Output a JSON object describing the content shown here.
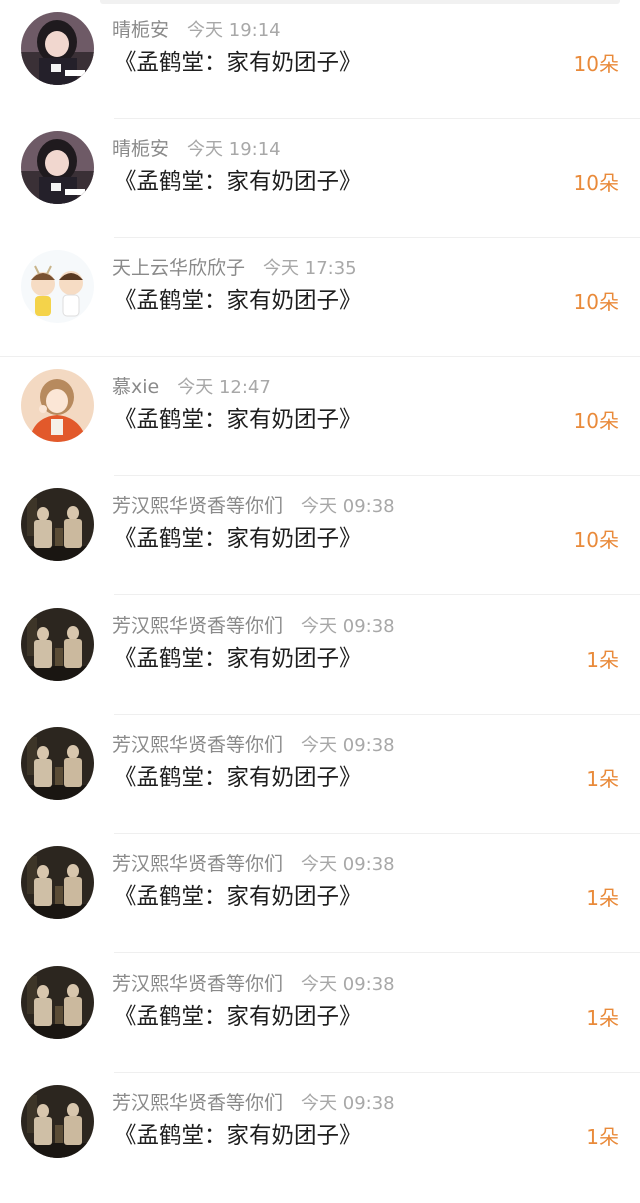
{
  "gifts": [
    {
      "avatar": "girl-dark-hair-avatar",
      "name": "晴栀安",
      "time": "今天 19:14",
      "title": "《孟鹤堂：家有奶团子》",
      "count": "10朵"
    },
    {
      "avatar": "girl-dark-hair-avatar",
      "name": "晴栀安",
      "time": "今天 19:14",
      "title": "《孟鹤堂：家有奶团子》",
      "count": "10朵"
    },
    {
      "avatar": "cartoon-kids-avatar",
      "name": "天上云华欣欣子",
      "time": "今天 17:35",
      "title": "《孟鹤堂：家有奶团子》",
      "count": "10朵"
    },
    {
      "avatar": "anime-boy-orange-avatar",
      "name": "慕xie",
      "time": "今天 12:47",
      "title": "《孟鹤堂：家有奶团子》",
      "count": "10朵"
    },
    {
      "avatar": "stage-duo-avatar",
      "name": "芳汉熙华贤香等你们",
      "time": "今天 09:38",
      "title": "《孟鹤堂：家有奶团子》",
      "count": "10朵"
    },
    {
      "avatar": "stage-duo-avatar",
      "name": "芳汉熙华贤香等你们",
      "time": "今天 09:38",
      "title": "《孟鹤堂：家有奶团子》",
      "count": "1朵"
    },
    {
      "avatar": "stage-duo-avatar",
      "name": "芳汉熙华贤香等你们",
      "time": "今天 09:38",
      "title": "《孟鹤堂：家有奶团子》",
      "count": "1朵"
    },
    {
      "avatar": "stage-duo-avatar",
      "name": "芳汉熙华贤香等你们",
      "time": "今天 09:38",
      "title": "《孟鹤堂：家有奶团子》",
      "count": "1朵"
    },
    {
      "avatar": "stage-duo-avatar",
      "name": "芳汉熙华贤香等你们",
      "time": "今天 09:38",
      "title": "《孟鹤堂：家有奶团子》",
      "count": "1朵"
    },
    {
      "avatar": "stage-duo-avatar",
      "name": "芳汉熙华贤香等你们",
      "time": "今天 09:38",
      "title": "《孟鹤堂：家有奶团子》",
      "count": "1朵"
    }
  ],
  "colors": {
    "count": "#e98a3a",
    "name": "#8a8a8a",
    "time": "#a8a8a8",
    "title": "#1e1e1e"
  }
}
